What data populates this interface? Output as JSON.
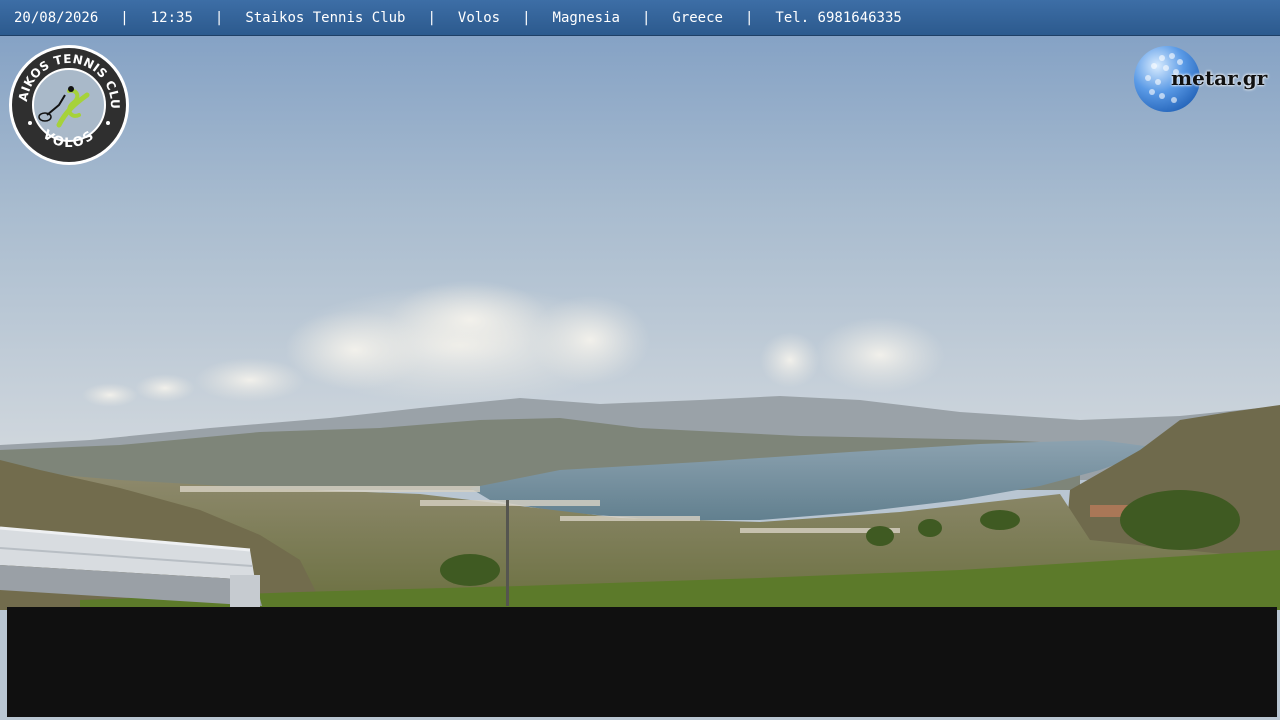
{
  "info_bar": {
    "date": "20/08/2026",
    "time": "12:35",
    "club": "Staikos Tennis Club",
    "city": "Volos",
    "region": "Magnesia",
    "country": "Greece",
    "phone": "Tel. 6981646335",
    "separator": "|"
  },
  "club_logo": {
    "top_text": "STAIKOS TENNIS CLUB",
    "bottom_text": "VOLOS",
    "accent_color": "#a6d23a"
  },
  "metar_logo": {
    "text": "metar.gr",
    "ball_color": "#3d7fd6"
  },
  "scene": {
    "sky_top": "#7f9fc4",
    "sky_horizon": "#d6dbe0",
    "sea": "#6f8a9c",
    "hills": "#6d7263",
    "foreground": "#5d7a2e"
  }
}
